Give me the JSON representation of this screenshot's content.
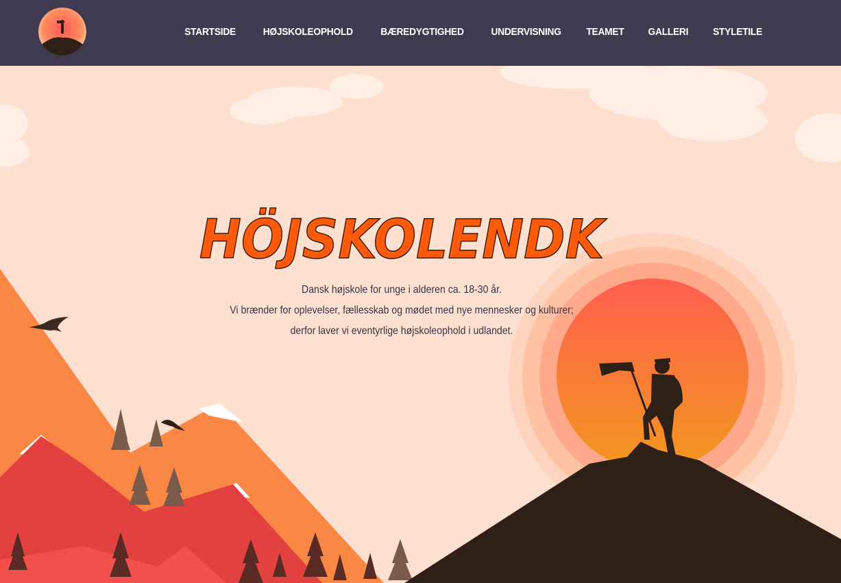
{
  "site": {
    "title": "Højskolendk"
  },
  "nav": {
    "items": [
      {
        "label": "STARTSIDE",
        "name": "nav-item-startside"
      },
      {
        "label": "HØJSKOLEOPHOLD",
        "name": "nav-item-hojskoleophold"
      },
      {
        "label": "BÆREDYGTIGHED",
        "name": "nav-item-baeredygtighed"
      },
      {
        "label": "UNDERVISNING",
        "name": "nav-item-undervisning"
      },
      {
        "label": "TEAMET",
        "name": "nav-item-teamet"
      },
      {
        "label": "GALLERI",
        "name": "nav-item-galleri"
      },
      {
        "label": "STYLETILE",
        "name": "nav-item-styletile"
      }
    ]
  },
  "hero": {
    "title": "HÖJSKOLENDK",
    "lines": [
      "Dansk højskole for unge i alderen ca. 18-30 år.",
      "Vi brænder for oplevelser, fællesskab og mødet med nye mennesker og kulturer;",
      "derfor laver vi eventyrlige højskoleophold i udlandet."
    ]
  },
  "colors": {
    "navbar": "#403a50",
    "sky": "#fde0cf",
    "title": "#ff5a0a",
    "text": "#3a3345",
    "sun_center": "#ff6a4a",
    "sun_edge": "#f59a2a",
    "silhouette": "#2e1f17"
  }
}
